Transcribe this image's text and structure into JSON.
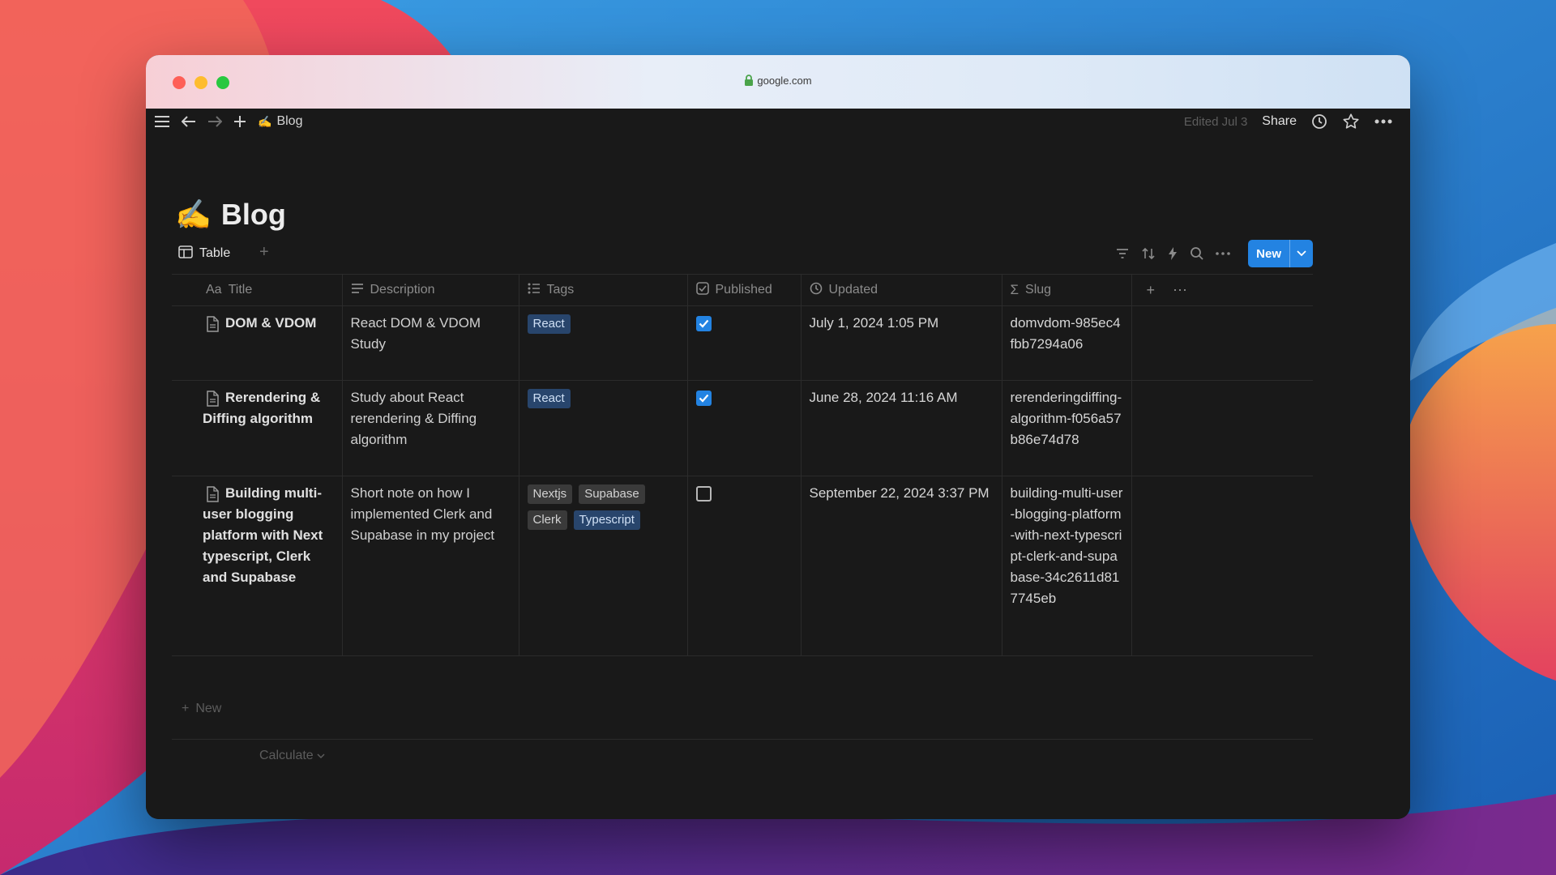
{
  "browser": {
    "url": "google.com"
  },
  "topbar": {
    "page_icon": "✍️",
    "breadcrumb": "Blog",
    "edited": "Edited Jul 3",
    "share_label": "Share"
  },
  "page": {
    "icon": "✍️",
    "title": "Blog"
  },
  "view": {
    "tab_label": "Table",
    "new_label": "New"
  },
  "columns": [
    "Title",
    "Description",
    "Tags",
    "Published",
    "Updated",
    "Slug"
  ],
  "column_prefix_title": "Aa",
  "rows": [
    {
      "title": "DOM & VDOM",
      "description": "React DOM & VDOM Study",
      "tags": [
        "React"
      ],
      "published": true,
      "updated": "July 1, 2024 1:05 PM",
      "slug": "domvdom-985ec4fbb7294a06"
    },
    {
      "title": "Rerendering & Diffing algorithm",
      "description": "Study about React rerendering & Diffing algorithm",
      "tags": [
        "React"
      ],
      "published": true,
      "updated": "June 28, 2024 11:16 AM",
      "slug": "rerenderingdiffing-algorithm-f056a57b86e74d78"
    },
    {
      "title": "Building multi-user blogging platform with Next typescript, Clerk and Supabase",
      "description": "Short note on how I implemented Clerk and Supabase in my project",
      "tags": [
        "Nextjs",
        "Supabase",
        "Clerk",
        "Typescript"
      ],
      "published": false,
      "updated": "September 22, 2024 3:37 PM",
      "slug": "building-multi-user-blogging-platform-with-next-typescript-clerk-and-supabase-34c2611d817745eb"
    }
  ],
  "footer": {
    "new_row_label": "New",
    "calculate_label": "Calculate"
  },
  "colors": {
    "accent": "#2383e2",
    "tag_blue": "#28456c",
    "tag_gray": "#3a3a3a",
    "app_bg": "#191919"
  }
}
